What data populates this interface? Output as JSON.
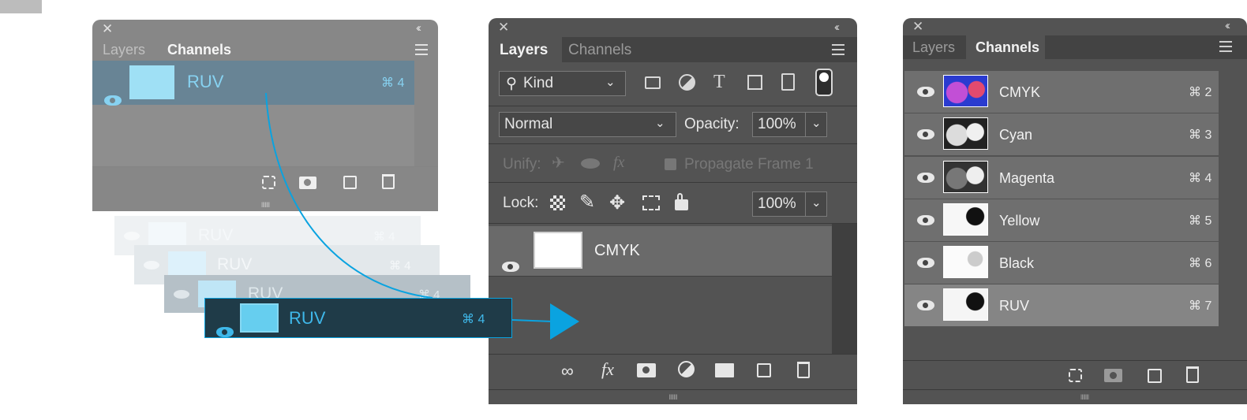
{
  "common": {
    "close_glyph": "✕",
    "collapse_glyph": "‹‹",
    "grip": "IIIIIII"
  },
  "panel1": {
    "tabs": [
      "Layers",
      "Channels"
    ],
    "active_tab": "Channels",
    "selected_row": {
      "label": "RUV",
      "shortcut": "⌘ 4"
    }
  },
  "ghost_rows": [
    {
      "label": "RUV",
      "shortcut": "⌘ 4"
    },
    {
      "label": "RUV",
      "shortcut": "⌘ 4"
    },
    {
      "label": "RUV",
      "shortcut": "⌘ 4"
    }
  ],
  "dragged_row": {
    "label": "RUV",
    "shortcut": "⌘ 4"
  },
  "panel2": {
    "tabs": [
      "Layers",
      "Channels"
    ],
    "active_tab": "Layers",
    "filter": {
      "value": "Kind"
    },
    "blend_mode": "Normal",
    "opacity_label": "Opacity:",
    "opacity_value": "100%",
    "unify_label": "Unify:",
    "unify_fx": "fx",
    "propagate_label": "Propagate Frame 1",
    "lock_label": "Lock:",
    "fill_value": "100%",
    "layer": {
      "name": "CMYK"
    },
    "footer_fx": "fx"
  },
  "panel3": {
    "tabs": [
      "Layers",
      "Channels"
    ],
    "active_tab": "Channels",
    "channels": [
      {
        "name": "CMYK",
        "shortcut": "⌘ 2"
      },
      {
        "name": "Cyan",
        "shortcut": "⌘ 3"
      },
      {
        "name": "Magenta",
        "shortcut": "⌘ 4"
      },
      {
        "name": "Yellow",
        "shortcut": "⌘ 5"
      },
      {
        "name": "Black",
        "shortcut": "⌘ 6"
      },
      {
        "name": "RUV",
        "shortcut": "⌘ 7"
      }
    ]
  },
  "colors": {
    "panel_bg": "#535353",
    "selection": "#1f3b48",
    "accent_blue": "#0aa3e0",
    "thumb_blue": "#66ceef"
  }
}
